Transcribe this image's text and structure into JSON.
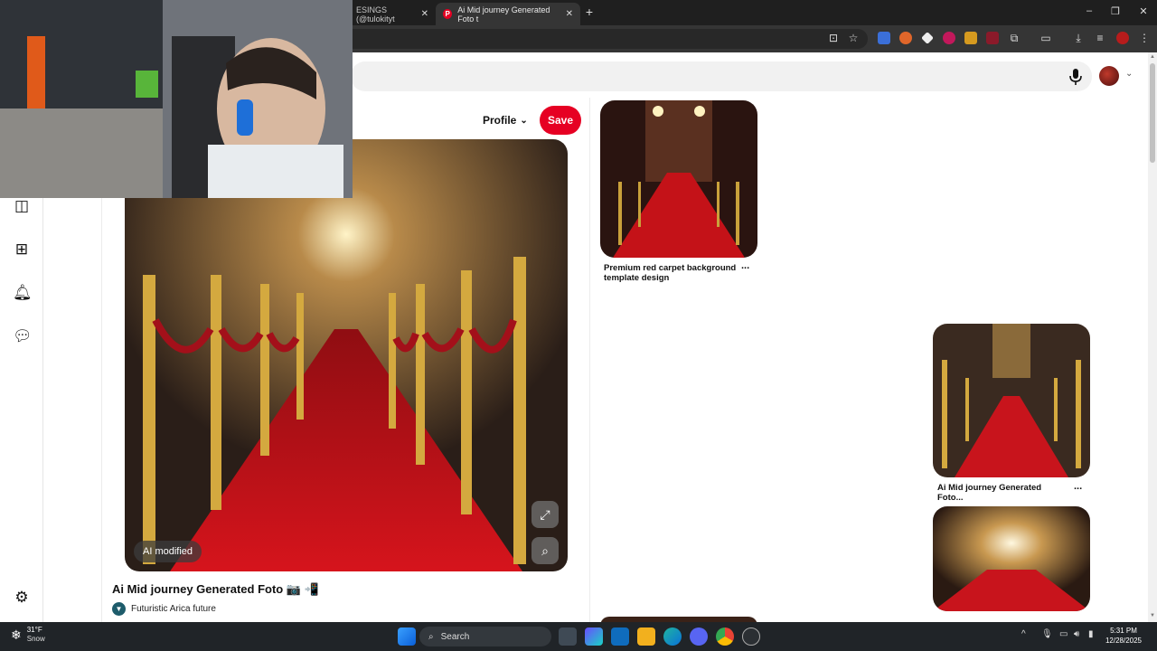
{
  "browser": {
    "tabs": [
      {
        "label": "ESINGS (@tulokityt",
        "active": false
      },
      {
        "label": "Ai Mid journey Generated Foto t",
        "active": true
      }
    ],
    "new_tab": "+",
    "window_controls": {
      "minimize": "–",
      "restore": "❐",
      "close": "✕"
    },
    "tab_close": "✕"
  },
  "header": {
    "profile_label": "Profile",
    "save_label": "Save"
  },
  "pin": {
    "title": "Ai Mid journey Generated Foto 📷 📲",
    "creator": "Futuristic Arica future",
    "badge": "AI modified",
    "expand_icon": "⤢",
    "lens_icon": "⌕"
  },
  "related": [
    {
      "title": "Premium red carpet background template design",
      "more": "..."
    },
    {
      "title": "Ai Mid journey Generated Foto...",
      "more": "..."
    }
  ],
  "colors": {
    "brand": "#e60023",
    "carpet": "#c4141c",
    "gold": "#c9a13b"
  },
  "taskbar": {
    "temperature": "31°F",
    "condition": "Snow",
    "search": "Search",
    "time": "5:31 PM",
    "date": "12/28/2025"
  }
}
